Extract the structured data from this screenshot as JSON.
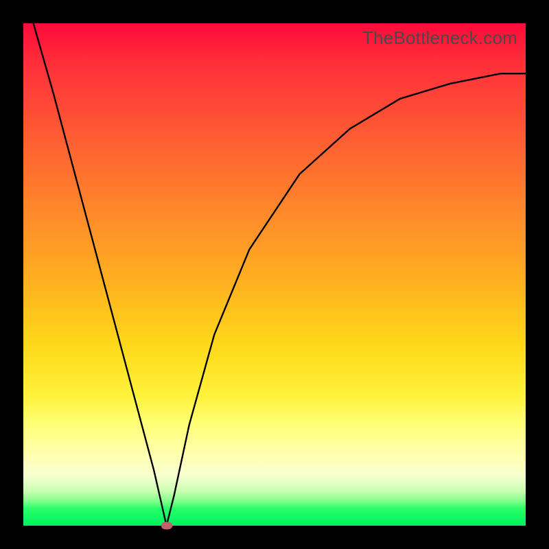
{
  "watermark": "TheBottleneck.com",
  "chart_data": {
    "type": "line",
    "title": "",
    "xlabel": "",
    "ylabel": "",
    "xlim": [
      0,
      1
    ],
    "ylim": [
      0,
      1
    ],
    "grid": false,
    "legend": false,
    "series": [
      {
        "name": "curve",
        "color": "#000000",
        "x": [
          0.02,
          0.06,
          0.1,
          0.14,
          0.18,
          0.22,
          0.26,
          0.285,
          0.3,
          0.33,
          0.38,
          0.45,
          0.55,
          0.65,
          0.75,
          0.85,
          0.95,
          1.0
        ],
        "values": [
          1.0,
          0.86,
          0.71,
          0.56,
          0.41,
          0.26,
          0.11,
          0.0,
          0.06,
          0.2,
          0.38,
          0.55,
          0.7,
          0.79,
          0.85,
          0.88,
          0.9,
          0.9
        ]
      }
    ],
    "marker": {
      "x": 0.285,
      "y": 0.0,
      "color": "#c3616a"
    },
    "background_gradient": {
      "stops": [
        {
          "pos": 0.0,
          "color": "#ff0a3a"
        },
        {
          "pos": 0.22,
          "color": "#ff5a33"
        },
        {
          "pos": 0.52,
          "color": "#ffb21f"
        },
        {
          "pos": 0.74,
          "color": "#fff23a"
        },
        {
          "pos": 0.9,
          "color": "#f7ffd0"
        },
        {
          "pos": 1.0,
          "color": "#00f060"
        }
      ]
    }
  }
}
